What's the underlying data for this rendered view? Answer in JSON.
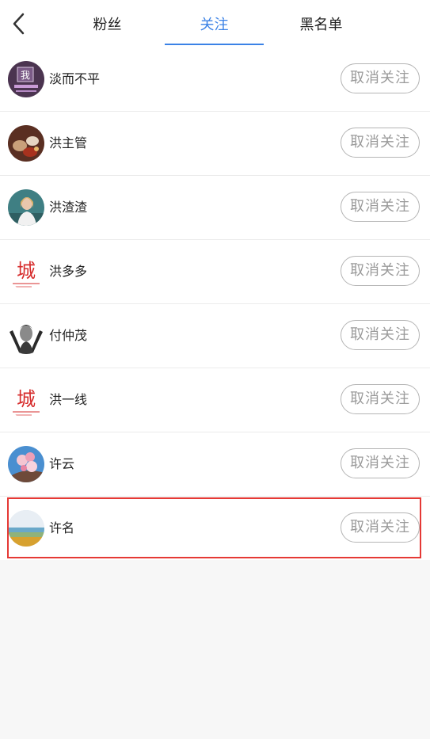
{
  "header": {
    "tabs": [
      {
        "label": "粉丝"
      },
      {
        "label": "关注"
      },
      {
        "label": "黑名单"
      }
    ],
    "active_tab": "关注",
    "accent_color": "#3b82e6"
  },
  "following": {
    "button_label": "取消关注",
    "items": [
      {
        "name": "淡而不平",
        "avatar": "purple-poster-avatar",
        "avatar_text": "我"
      },
      {
        "name": "洪主管",
        "avatar": "food-table-avatar"
      },
      {
        "name": "洪渣渣",
        "avatar": "woman-portrait-avatar"
      },
      {
        "name": "洪多多",
        "avatar": "red-calligraphy-avatar",
        "avatar_text": "城"
      },
      {
        "name": "付仲茂",
        "avatar": "bw-man-portrait-avatar"
      },
      {
        "name": "洪一线",
        "avatar": "red-calligraphy-avatar",
        "avatar_text": "城"
      },
      {
        "name": "许云",
        "avatar": "peach-blossom-avatar"
      },
      {
        "name": "许名",
        "avatar": "landscape-avatar"
      }
    ]
  },
  "highlight": {
    "color": "#e53935",
    "target_index": 7
  }
}
